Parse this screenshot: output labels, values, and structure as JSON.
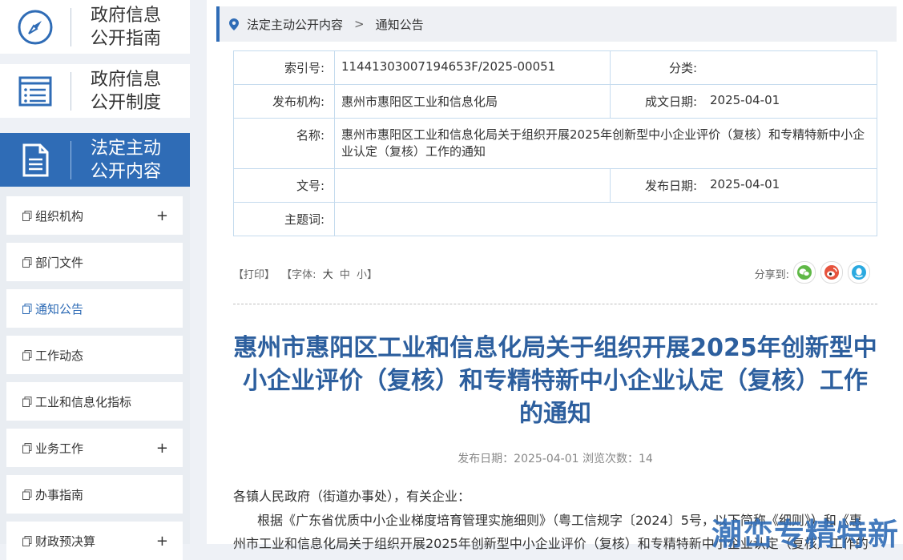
{
  "sidebar": {
    "big_buttons": [
      {
        "line1": "政府信息",
        "line2": "公开指南",
        "icon": "compass-icon"
      },
      {
        "line1": "政府信息",
        "line2": "公开制度",
        "icon": "list-icon"
      },
      {
        "line1": "法定主动",
        "line2": "公开内容",
        "icon": "document-icon"
      }
    ],
    "items": [
      {
        "label": "组织机构",
        "expand": "+"
      },
      {
        "label": "部门文件",
        "expand": ""
      },
      {
        "label": "通知公告",
        "expand": ""
      },
      {
        "label": "工作动态",
        "expand": ""
      },
      {
        "label": "工业和信息化指标",
        "expand": ""
      },
      {
        "label": "业务工作",
        "expand": "+"
      },
      {
        "label": "办事指南",
        "expand": ""
      },
      {
        "label": "财政预决算",
        "expand": "+"
      }
    ],
    "active_color": "#2f6cb6"
  },
  "breadcrumb": {
    "items": [
      "法定主动公开内容",
      "通知公告"
    ],
    "separator": ">"
  },
  "meta": {
    "index_label": "索引号:",
    "index_value": "11441303007194653F/2025-00051",
    "category_label": "分类:",
    "category_value": "",
    "org_label": "发布机构:",
    "org_value": "惠州市惠阳区工业和信息化局",
    "created_label": "成文日期:",
    "created_value": "2025-04-01",
    "name_label": "名称:",
    "name_value": "惠州市惠阳区工业和信息化局关于组织开展2025年创新型中小企业评价（复核）和专精特新中小企业认定（复核）工作的通知",
    "docno_label": "文号:",
    "docno_value": "",
    "pubdate_label": "发布日期:",
    "pubdate_value": "2025-04-01",
    "keywords_label": "主题词:",
    "keywords_value": ""
  },
  "tools": {
    "print": "【打印】",
    "font_prefix": "【字体:",
    "font_large": "大",
    "font_medium": "中",
    "font_small": "小】",
    "share_label": "分享到:",
    "share_icons": [
      "wechat-icon",
      "weibo-icon",
      "qq-icon"
    ]
  },
  "article": {
    "title": "惠州市惠阳区工业和信息化局关于组织开展2025年创新型中小企业评价（复核）和专精特新中小企业认定（复核）工作的通知",
    "pub_info": "发布日期：2025-04-01   浏览次数：14",
    "salutation": "各镇人民政府（街道办事处），有关企业：",
    "para1": "根据《广东省优质中小企业梯度培育管理实施细则》（粤工信规字〔2024〕5号，以下简称《细则》）和《惠",
    "para2": "州市工业和信息化局关于组织开展2025年创新型中小企业评价（复核）和专精特新中小企业认定（复核）工作的"
  },
  "watermark": "潮峦专精特新"
}
